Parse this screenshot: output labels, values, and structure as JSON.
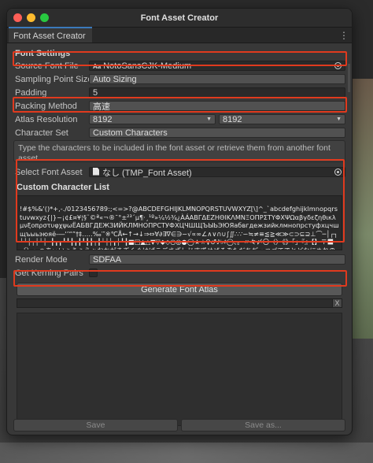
{
  "window": {
    "title": "Font Asset Creator",
    "tab_label": "Font Asset Creator",
    "tab_menu_glyph": "⋮"
  },
  "settings": {
    "section_title": "Font Settings",
    "source_font_file": {
      "label": "Source Font File",
      "value": "NotoSansCJK-Medium",
      "badge": "Aa"
    },
    "sampling_point_size": {
      "label": "Sampling Point Size",
      "value": "Auto Sizing"
    },
    "padding": {
      "label": "Padding",
      "value": "5"
    },
    "packing_method": {
      "label": "Packing Method",
      "value": "高速"
    },
    "atlas_resolution": {
      "label": "Atlas Resolution",
      "width": "8192",
      "height": "8192"
    },
    "character_set": {
      "label": "Character Set",
      "value": "Custom Characters"
    },
    "help_text": "Type the characters to be included in the font asset or retrieve them from another font asset.",
    "select_font_asset": {
      "label": "Select Font Asset",
      "value": "なし (TMP_Font Asset)"
    },
    "custom_character_list": {
      "title": "Custom Character List",
      "text": "!#$%&'()*+,-./0123456789:;<=>?@ABCDEFGHIJKLMNOPQRSTUVWXYZ[\\]^_`abcdefghijklmnopqrstuvwxyz{|}~¡¢£¤¥¦§¨©ª«¬®¯°±²³´µ¶·¸¹º»¼½¾¿ÀÁΑΒΓΔΕΖΗΘΙΚΛΜΝΞΟΠΡΣΤΥΦΧΨΩαβγδεζηθικλμνξοπρστυφχψωЁАБВГДЕЖЗИЙКЛМНОПРСТУФХЦЧШЩЪЫЬЭЮЯабвгдежзийклмнопрстуфхцчшщъыьэюяё‐―‘’“”†‡‥…‰′″※℃Å←↑→↓⇒⇔∀∂∃∇∈∋−√∝∞∠∧∨∩∪∫∬∴∵∽≒≠≡≦≧≪≫⊂⊃⊆⊇⊥⌒─│┌┐┘└├┬┤┴┼━┃┏┓┛┗┣┳┫┻╋┠┯┨┷┿┝┰┥┸╂■□▲△▼▽◆◇○◎●◯★☆♀♂♪♭♯◯、。〃々〆〇〈〉《》「」『』【】〒〓〔〕〜ぁあぃいぅうぇえぉおかがきぎくぐけげこごさざしじすずせぜそぞただちぢっつづてでとどなにぬねのはばぱひびぴふぶぷへべぺほぼぽまみむめもゃやゅゆょよらりるれろゎわゐゑをんゝゞァアィイゥウ"
    },
    "render_mode": {
      "label": "Render Mode",
      "value": "SDFAA"
    },
    "get_kerning_pairs": {
      "label": "Get Kerning Pairs"
    }
  },
  "actions": {
    "generate_label": "Generate Font Atlas",
    "progress_percent": 0,
    "progress_cancel": "X",
    "save_label": "Save",
    "save_as_label": "Save as..."
  },
  "colors": {
    "highlight": "#e03a1e",
    "tab_accent": "#3a79bb"
  }
}
